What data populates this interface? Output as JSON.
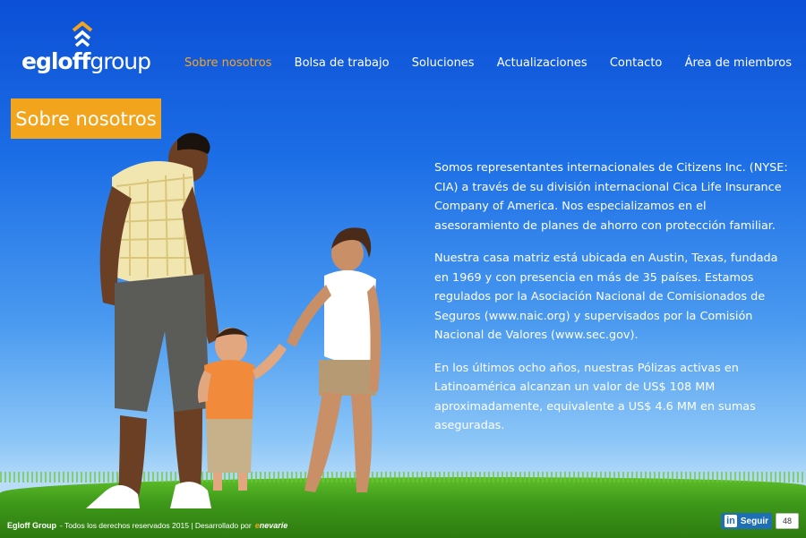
{
  "header": {
    "logo_bold": "egloff",
    "logo_light": "group",
    "nav": [
      {
        "label": "Sobre nosotros",
        "active": true
      },
      {
        "label": "Bolsa de trabajo"
      },
      {
        "label": "Soluciones"
      },
      {
        "label": "Actualizaciones"
      },
      {
        "label": "Contacto"
      },
      {
        "label": "Área de miembros"
      }
    ]
  },
  "section": {
    "title": "Sobre nosotros",
    "paragraphs": [
      "Somos representantes internacionales de Citizens Inc. (NYSE: CIA) a través de su división internacional Cica Life Insurance Company of America. Nos especializamos en el asesoramiento de planes de ahorro con protección familiar.",
      "Nuestra casa matriz está ubicada en Austin, Texas, fundada en 1969 y con presencia en más de 35 países. Estamos regulados por la Asociación Nacional de Comisionados de Seguros (www.naic.org) y supervisados por la Comisión Nacional de Valores (www.sec.gov).",
      "En los últimos ocho años, nuestras Pólizas activas en Latinoamérica alcanzan un valor de US$ 108 MM aproximadamente, equivalente a US$ 4.6 MM en sumas aseguradas."
    ]
  },
  "footer": {
    "brand": "Egloff Group",
    "text": "- Todos los derechos reservados 2015 | Desarrollado por",
    "dev_logo": "nevarie"
  },
  "linkedin": {
    "in": "in",
    "label": "Seguir",
    "count": "48"
  },
  "colors": {
    "accent": "#f2a41c",
    "nav_active": "#f5a623",
    "sky": "#1d6fe6"
  }
}
